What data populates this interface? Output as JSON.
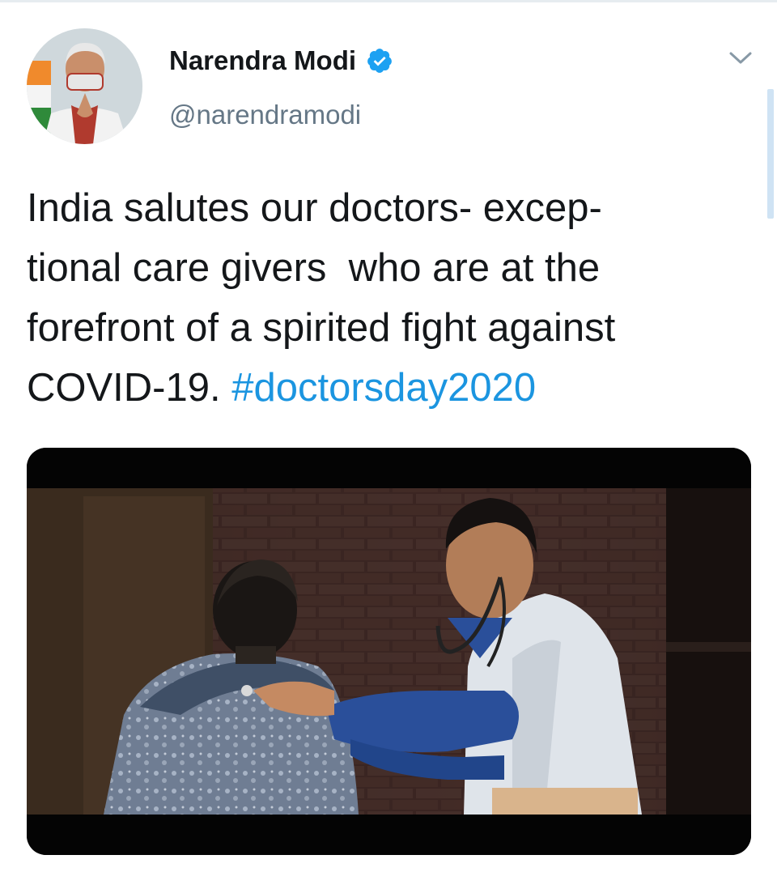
{
  "tweet": {
    "author": {
      "display_name": "Narendra Modi",
      "handle": "@narendramodi",
      "verified": true,
      "avatar_icon": "profile-photo"
    },
    "text_lines": [
      "India salutes our doctors- excep-",
      "tional care givers  who are at the",
      "forefront of a spirited fight against",
      "COVID-19. "
    ],
    "hashtag": "#doctorsday2020",
    "media": {
      "type": "video-still",
      "alt_icon": "doctor-examining-patient-image"
    }
  },
  "icons": {
    "verified": "verified-badge-icon",
    "menu": "chevron-down-icon"
  },
  "colors": {
    "text_primary": "#14171a",
    "text_secondary": "#657786",
    "link": "#1b95e0",
    "verified": "#1da1f2"
  }
}
